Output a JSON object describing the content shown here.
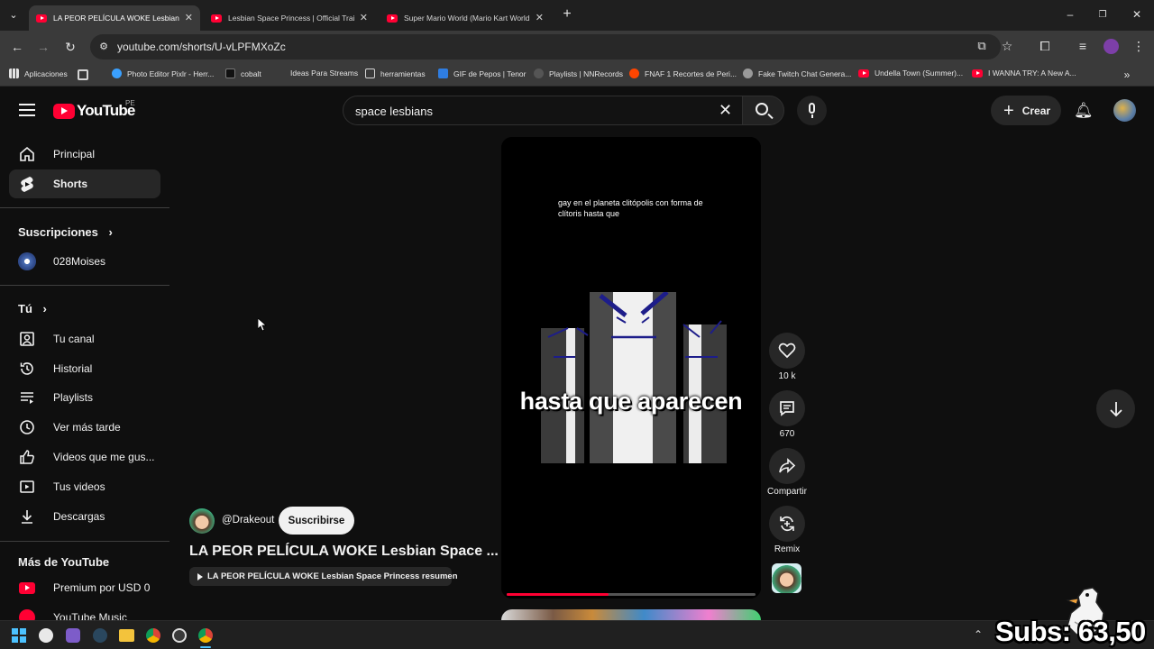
{
  "browser": {
    "tabs": [
      {
        "title": "LA PEOR PELÍCULA WOKE Lesbian Spa",
        "active": true
      },
      {
        "title": "Lesbian Space Princess | Official Traile",
        "active": false
      },
      {
        "title": "Super Mario World (Mario Kart World",
        "active": false
      }
    ],
    "url": "youtube.com/shorts/U-vLPFMXoZc",
    "bookmarks": [
      "Aplicaciones",
      "Photo Editor Pixlr - Herr...",
      "cobalt",
      "Ideas Para Streams",
      "herramientas",
      "GIF de Pepos | Tenor",
      "Playlists | NNRecords",
      "FNAF 1 Recortes de Peri...",
      "Fake Twitch Chat Genera...",
      "Undella Town (Summer)...",
      "I WANNA TRY: A New A..."
    ]
  },
  "youtube": {
    "logo_text": "YouTube",
    "country_code": "PE",
    "search_value": "space lesbians",
    "create_label": "Crear",
    "sidebar": {
      "main": [
        {
          "label": "Principal",
          "icon": "home-icon"
        },
        {
          "label": "Shorts",
          "icon": "shorts-icon",
          "active": true
        }
      ],
      "subscriptions_title": "Suscripciones",
      "subscriptions": [
        {
          "label": "028Moises"
        }
      ],
      "you_title": "Tú",
      "you_items": [
        {
          "label": "Tu canal",
          "icon": "channel-icon"
        },
        {
          "label": "Historial",
          "icon": "history-icon"
        },
        {
          "label": "Playlists",
          "icon": "playlists-icon"
        },
        {
          "label": "Ver más tarde",
          "icon": "watch-later-icon"
        },
        {
          "label": "Videos que me gus...",
          "icon": "like-icon"
        },
        {
          "label": "Tus videos",
          "icon": "your-videos-icon"
        },
        {
          "label": "Descargas",
          "icon": "download-icon"
        }
      ],
      "more_title": "Más de YouTube",
      "more_items": [
        {
          "label": "Premium por USD 0",
          "icon": "premium-icon"
        },
        {
          "label": "YouTube Music",
          "icon": "music-icon"
        }
      ]
    },
    "short": {
      "caption_small": "gay en el planeta clitópolis con forma de clítoris hasta que",
      "caption_big": "hasta que aparecen",
      "channel": "@Drakeout",
      "subscribe_label": "Suscribirse",
      "title": "LA PEOR PELÍCULA WOKE Lesbian Space ...",
      "playlist_label": "LA PEOR PELÍCULA WOKE Lesbian Space Princess resumen",
      "progress": 0.41,
      "actions": {
        "likes": "10 k",
        "comments": "670",
        "share": "Compartir",
        "remix": "Remix"
      }
    }
  },
  "overlay": {
    "subs_text": "Subs: 63,50"
  },
  "colors": {
    "yt_red": "#ff0033",
    "background": "#0f0f0f",
    "progress": "#ff0033"
  }
}
